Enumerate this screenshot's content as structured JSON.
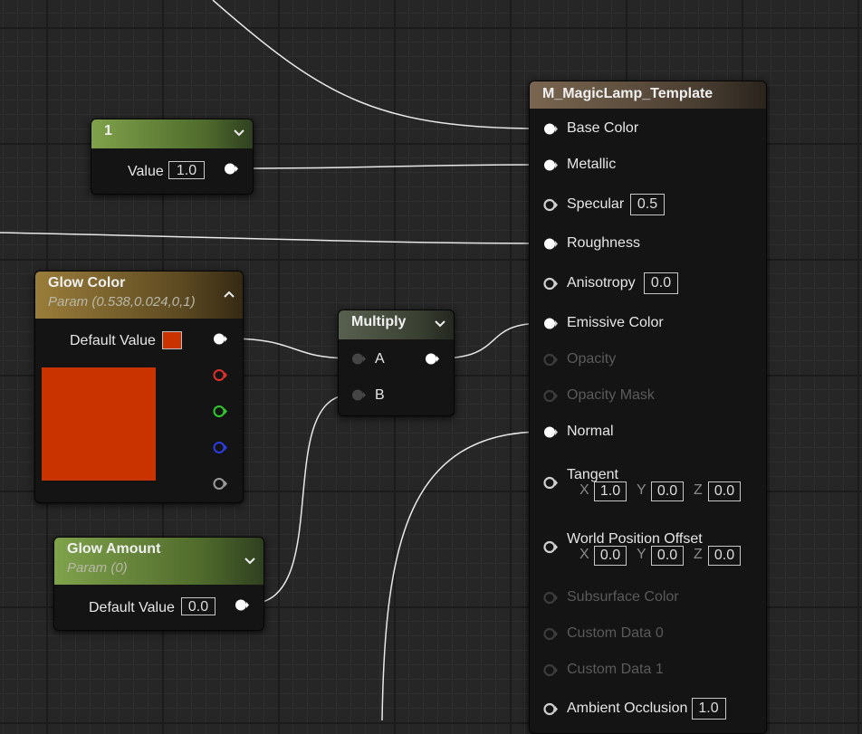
{
  "material_node": {
    "title": "M_MagicLamp_Template",
    "pins": [
      {
        "label": "Base Color",
        "connected": true,
        "enabled": true
      },
      {
        "label": "Metallic",
        "connected": true,
        "enabled": true
      },
      {
        "label": "Specular",
        "connected": false,
        "enabled": true,
        "value": "0.5"
      },
      {
        "label": "Roughness",
        "connected": true,
        "enabled": true
      },
      {
        "label": "Anisotropy",
        "connected": false,
        "enabled": true,
        "value": "0.0"
      },
      {
        "label": "Emissive Color",
        "connected": true,
        "enabled": true
      },
      {
        "label": "Opacity",
        "connected": false,
        "enabled": false
      },
      {
        "label": "Opacity Mask",
        "connected": false,
        "enabled": false
      },
      {
        "label": "Normal",
        "connected": true,
        "enabled": true
      },
      {
        "label": "Tangent",
        "connected": false,
        "enabled": true,
        "x": "1.0",
        "y": "0.0",
        "z": "0.0"
      },
      {
        "label": "World Position Offset",
        "connected": false,
        "enabled": true,
        "x": "0.0",
        "y": "0.0",
        "z": "0.0"
      },
      {
        "label": "Subsurface Color",
        "connected": false,
        "enabled": false
      },
      {
        "label": "Custom Data 0",
        "connected": false,
        "enabled": false
      },
      {
        "label": "Custom Data 1",
        "connected": false,
        "enabled": false
      },
      {
        "label": "Ambient Occlusion",
        "connected": false,
        "enabled": true,
        "value": "1.0"
      }
    ],
    "axis_labels": {
      "x": "X",
      "y": "Y",
      "z": "Z"
    }
  },
  "constant_node": {
    "title": "1",
    "value_label": "Value",
    "value": "1.0"
  },
  "glow_color_node": {
    "title": "Glow Color",
    "subtitle": "Param (0.538,0.024,0,1)",
    "default_label": "Default Value",
    "color": "#c93300",
    "channel_pins": [
      "red",
      "green",
      "blue",
      "alpha"
    ],
    "channel_colors": [
      "#e0312b",
      "#2fc92f",
      "#2b3be0",
      "#9a9a9a"
    ]
  },
  "multiply_node": {
    "title": "Multiply",
    "input_a": "A",
    "input_b": "B"
  },
  "glow_amount_node": {
    "title": "Glow Amount",
    "subtitle": "Param (0)",
    "default_label": "Default Value",
    "value": "0.0"
  },
  "wire_color": "#e8e8e8"
}
